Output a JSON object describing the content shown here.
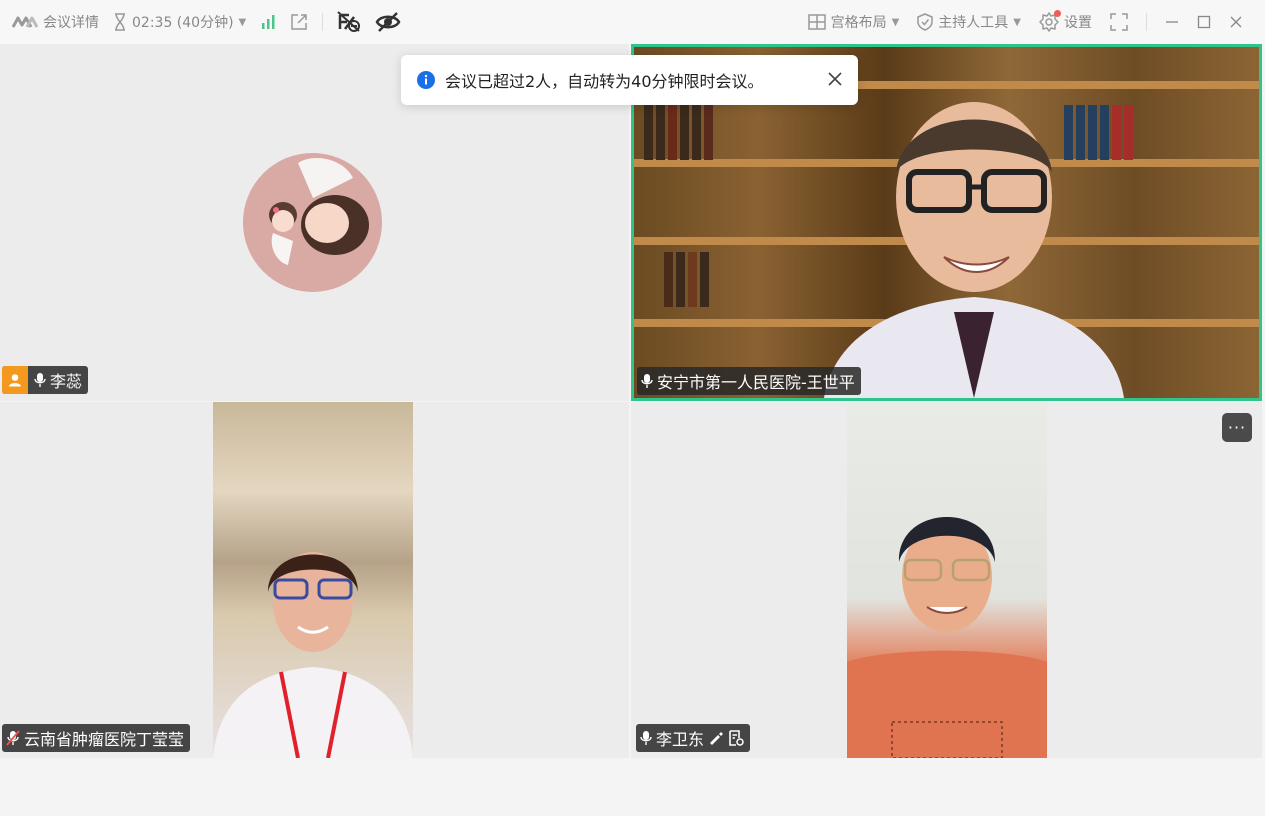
{
  "toolbar": {
    "meeting_details": "会议详情",
    "timer": "02:35 (40分钟)",
    "layout": "宫格布局",
    "host_tools": "主持人工具",
    "settings": "设置"
  },
  "toast": {
    "message": "会议已超过2人，自动转为40分钟限时会议。"
  },
  "participants": [
    {
      "name": "李蕊",
      "host": true
    },
    {
      "name": "安宁市第一人民医院-王世平"
    },
    {
      "name": "云南省肿瘤医院丁莹莹",
      "muted": true
    },
    {
      "name": "李卫东"
    }
  ],
  "colors": {
    "active_speaker": "#2fc48a",
    "host_badge": "#f39a1e",
    "info": "#1a6fe8"
  }
}
